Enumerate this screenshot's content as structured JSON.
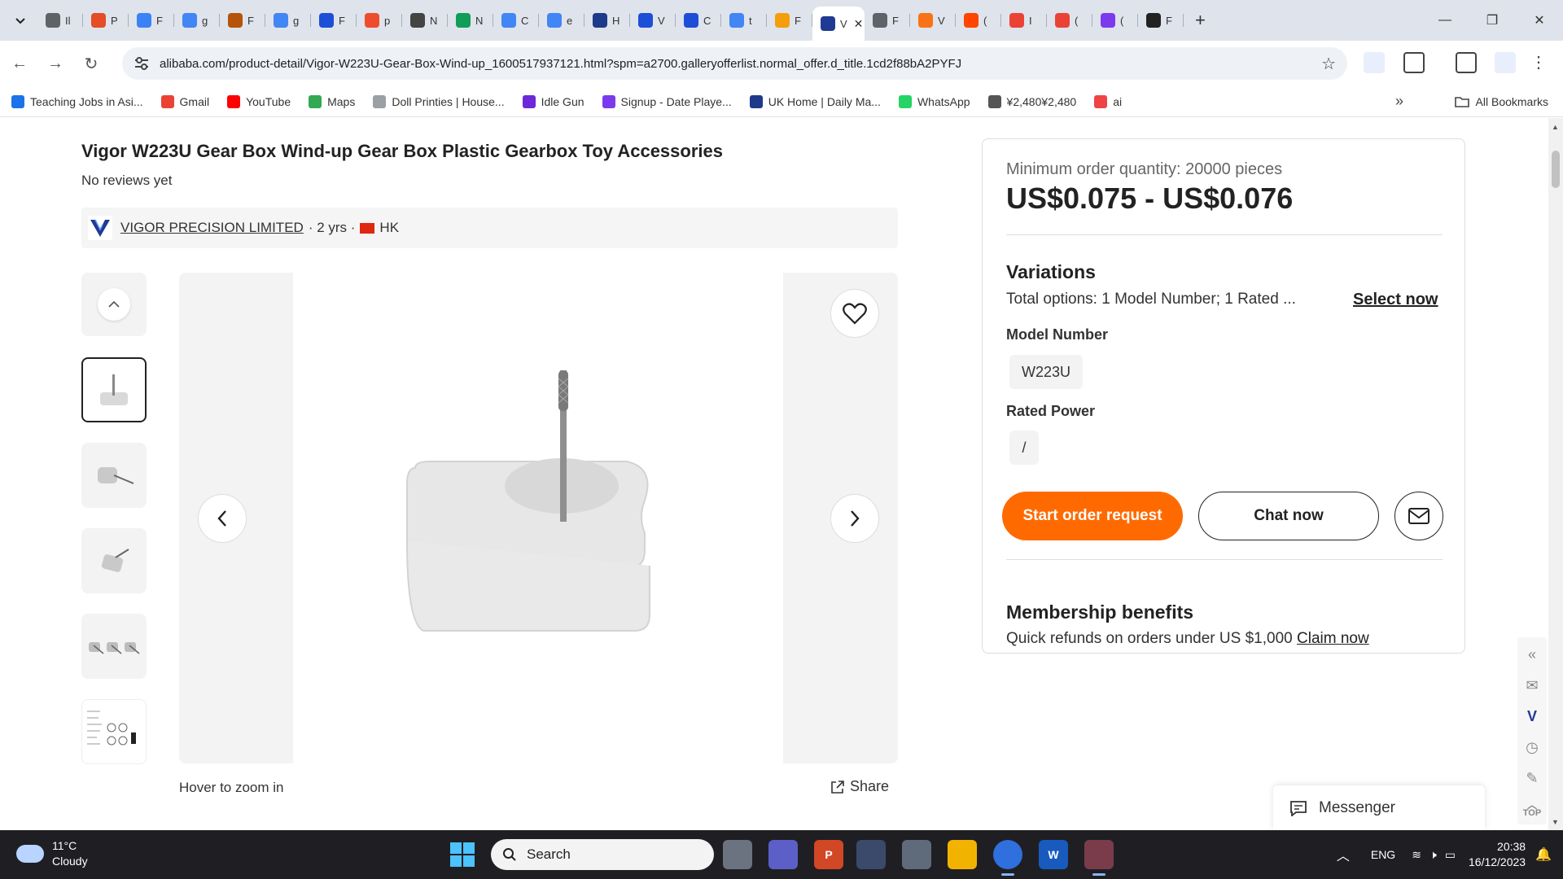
{
  "browser": {
    "tabs": [
      {
        "label": "Il",
        "color": "#5f6368"
      },
      {
        "label": "P",
        "color": "#e44d26"
      },
      {
        "label": "F",
        "color": "#3b82f6"
      },
      {
        "label": "g",
        "color": "#4285f4"
      },
      {
        "label": "F",
        "color": "#b45309"
      },
      {
        "label": "g",
        "color": "#4285f4"
      },
      {
        "label": "F",
        "color": "#1d4ed8"
      },
      {
        "label": "p",
        "color": "#ee4d2d"
      },
      {
        "label": "N",
        "color": "#444444"
      },
      {
        "label": "N",
        "color": "#0f9d58"
      },
      {
        "label": "C",
        "color": "#4285f4"
      },
      {
        "label": "e",
        "color": "#4285f4"
      },
      {
        "label": "H",
        "color": "#1e3a8a"
      },
      {
        "label": "V",
        "color": "#1d4ed8"
      },
      {
        "label": "C",
        "color": "#1d4ed8"
      },
      {
        "label": "t",
        "color": "#4285f4"
      },
      {
        "label": "F",
        "color": "#f59e0b"
      },
      {
        "label": "V",
        "color": "#1f3a93",
        "active": true
      },
      {
        "label": "F",
        "color": "#5f6368"
      },
      {
        "label": "V",
        "color": "#f97316"
      },
      {
        "label": "(",
        "color": "#ff4500"
      },
      {
        "label": "I",
        "color": "#ea4335"
      },
      {
        "label": "(",
        "color": "#ea4335"
      },
      {
        "label": "(",
        "color": "#7c3aed"
      },
      {
        "label": "F",
        "color": "#222222"
      }
    ],
    "url": "alibaba.com/product-detail/Vigor-W223U-Gear-Box-Wind-up_1600517937121.html?spm=a2700.galleryofferlist.normal_offer.d_title.1cd2f88bA2PYFJ",
    "bookmarks": [
      {
        "label": "Teaching Jobs in Asi...",
        "color": "#1a73e8"
      },
      {
        "label": "Gmail",
        "color": "#ea4335"
      },
      {
        "label": "YouTube",
        "color": "#ff0000"
      },
      {
        "label": "Maps",
        "color": "#34a853"
      },
      {
        "label": "Doll Printies | House...",
        "color": "#9aa0a6"
      },
      {
        "label": "Idle Gun",
        "color": "#6d28d9"
      },
      {
        "label": "Signup - Date Playe...",
        "color": "#7c3aed"
      },
      {
        "label": "UK Home | Daily Ma...",
        "color": "#1e3a8a"
      },
      {
        "label": "WhatsApp",
        "color": "#25d366"
      },
      {
        "label": "¥2,480¥2,480",
        "color": "#555555"
      },
      {
        "label": "ai",
        "color": "#ef4444"
      }
    ],
    "all_bookmarks": "All Bookmarks"
  },
  "product": {
    "title": "Vigor W223U Gear Box Wind-up Gear Box Plastic Gearbox Toy Accessories",
    "reviews": "No reviews yet",
    "supplier_name": "VIGOR PRECISION LIMITED",
    "supplier_years": "· 2 yrs ·",
    "supplier_country": "HK",
    "hover_zoom": "Hover to zoom in",
    "share": "Share"
  },
  "panel": {
    "moq": "Minimum order quantity: 20000 pieces",
    "price": "US$0.075 - US$0.076",
    "variations_heading": "Variations",
    "variations_total": "Total options: 1 Model Number; 1 Rated ...",
    "select_now": "Select now",
    "model_label": "Model Number",
    "model_value": "W223U",
    "power_label": "Rated Power",
    "power_value": "/",
    "order_button": "Start order request",
    "chat_button": "Chat now",
    "membership_heading": "Membership benefits",
    "membership_text": "Quick refunds on orders under US $1,000",
    "claim_now": "Claim now",
    "accent": "#ff6a00"
  },
  "floating": {
    "messenger": "Messenger",
    "top": "TOP"
  },
  "taskbar": {
    "temperature": "11°C",
    "condition": "Cloudy",
    "search_placeholder": "Search",
    "language": "ENG",
    "time": "20:38",
    "date": "16/12/2023"
  }
}
